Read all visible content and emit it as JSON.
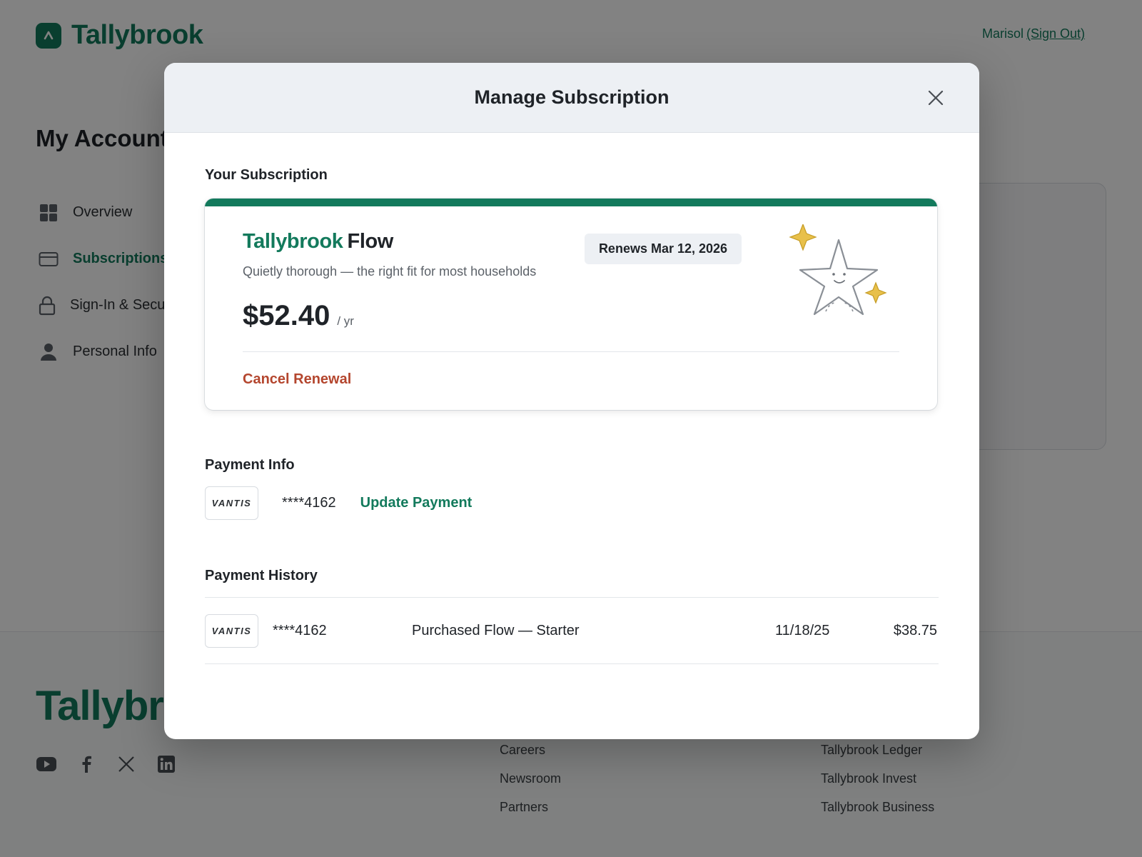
{
  "header": {
    "brand": "Tallybrook",
    "user_name": "Marisol",
    "sign_out_label": "(Sign Out)"
  },
  "account": {
    "title": "My Account",
    "nav": [
      {
        "label": "Overview",
        "icon": "grid-icon"
      },
      {
        "label": "Subscriptions",
        "icon": "credit-card-icon",
        "active": true
      },
      {
        "label": "Sign-In & Security",
        "icon": "lock-icon"
      },
      {
        "label": "Personal Info",
        "icon": "person-icon"
      }
    ]
  },
  "footer": {
    "brand": "Tallybrook",
    "socials": [
      "youtube-icon",
      "facebook-icon",
      "x-icon",
      "linkedin-icon"
    ],
    "col_a": [
      "Careers",
      "Newsroom",
      "Partners"
    ],
    "col_b": [
      "Tallybrook Ledger",
      "Tallybrook Invest",
      "Tallybrook Business"
    ]
  },
  "modal": {
    "title": "Manage Subscription",
    "subscription": {
      "section_label": "Your Subscription",
      "plan_brand": "Tallybrook",
      "plan_name": "Flow",
      "description": "Quietly thorough — the right fit for most households",
      "renews": "Renews Mar 12, 2026",
      "price": "$52.40",
      "period": "/ yr",
      "cancel_label": "Cancel Renewal"
    },
    "payment_info": {
      "section_label": "Payment Info",
      "card_brand": "VANTIS",
      "masked_number": "****4162",
      "update_label": "Update Payment"
    },
    "payment_history": {
      "section_label": "Payment History",
      "rows": [
        {
          "card_brand": "VANTIS",
          "masked_number": "****4162",
          "description": "Purchased Flow — Starter",
          "date": "11/18/25",
          "amount": "$38.75"
        }
      ]
    }
  },
  "colors": {
    "brand_green": "#137a5c",
    "cancel_red": "#b4462e",
    "sparkle_gold": "#e8c04a"
  }
}
